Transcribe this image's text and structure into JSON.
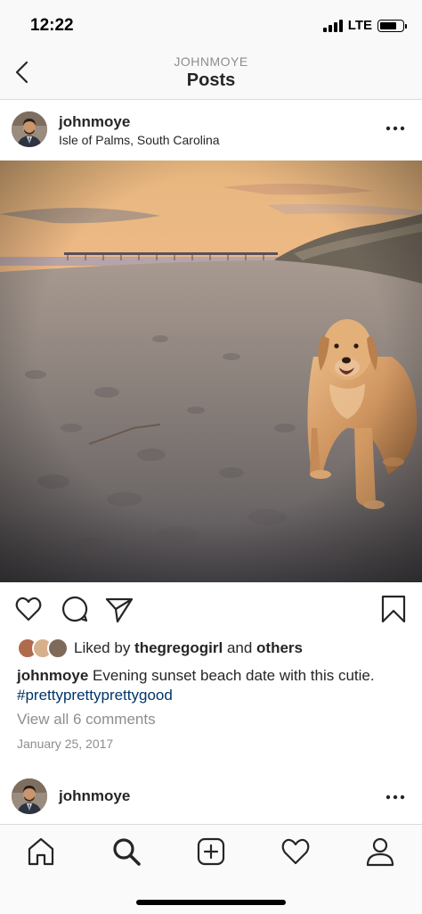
{
  "status_bar": {
    "time": "12:22",
    "network": "LTE",
    "battery_level": 0.75
  },
  "header": {
    "subtitle": "JOHNMOYE",
    "title": "Posts",
    "back_icon": "chevron-left-icon"
  },
  "post": {
    "username": "johnmoye",
    "location": "Isle of Palms, South Carolina",
    "more_icon": "more-horizontal-icon",
    "image_alt": "Golden retriever sitting on a beach at sunset with a pier in the background",
    "actions": {
      "like_icon": "heart-icon",
      "comment_icon": "comment-icon",
      "share_icon": "send-icon",
      "save_icon": "bookmark-icon"
    },
    "likes": {
      "prefix": "Liked by ",
      "user": "thegregogirl",
      "conjunction": " and ",
      "others": "others"
    },
    "caption": {
      "user": "johnmoye",
      "text": " Evening sunset beach date with this cutie. ",
      "hashtag": "#prettyprettyprettygood"
    },
    "view_comments": "View all 6 comments",
    "date": "January 25, 2017"
  },
  "next_post": {
    "username": "johnmoye",
    "more_icon": "more-horizontal-icon"
  },
  "tab_bar": {
    "items": [
      {
        "name": "home",
        "icon": "home-icon"
      },
      {
        "name": "search",
        "icon": "search-icon",
        "active": true
      },
      {
        "name": "new-post",
        "icon": "plus-square-icon"
      },
      {
        "name": "activity",
        "icon": "heart-icon"
      },
      {
        "name": "profile",
        "icon": "user-icon"
      }
    ]
  },
  "colors": {
    "link": "#003569",
    "muted": "#8e8e8e",
    "text": "#262626",
    "divider": "#dbdbdb"
  }
}
